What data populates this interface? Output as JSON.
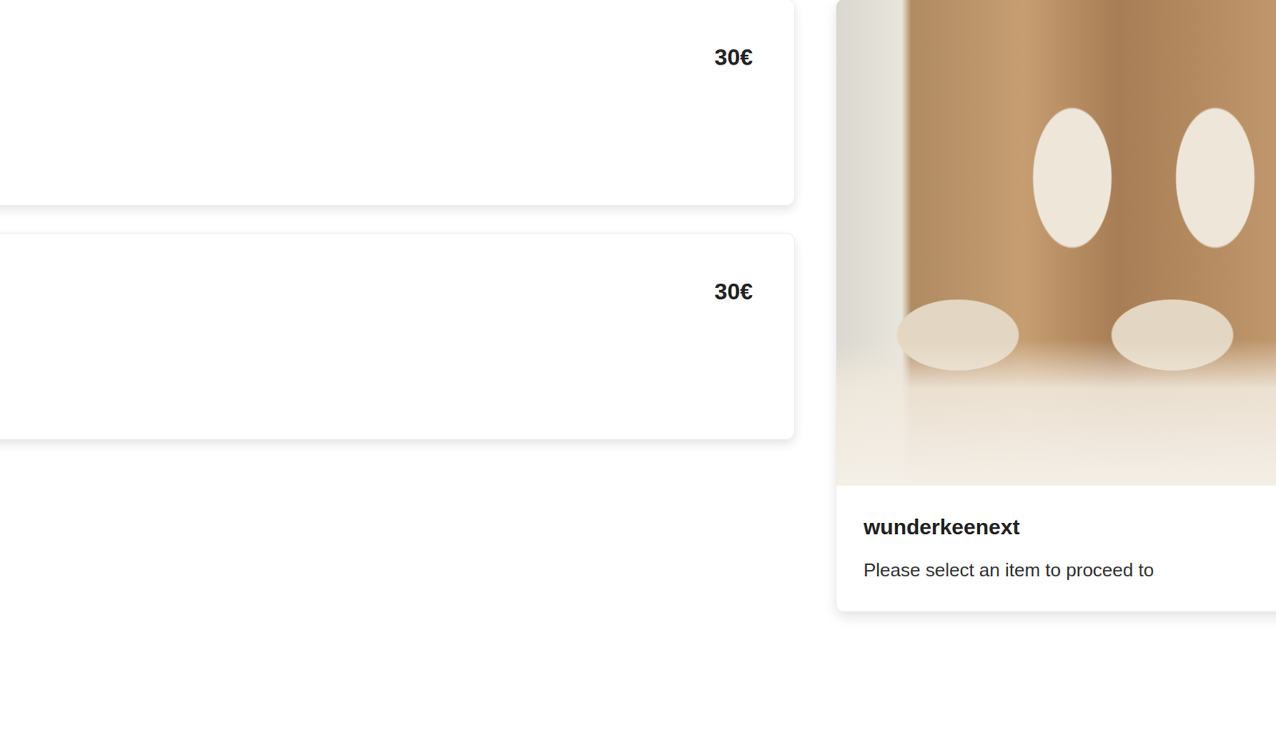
{
  "items": [
    {
      "price": "30€"
    },
    {
      "price": "30€"
    }
  ],
  "side": {
    "title": "wunderkeenext",
    "text": "Please select an item to proceed to"
  }
}
